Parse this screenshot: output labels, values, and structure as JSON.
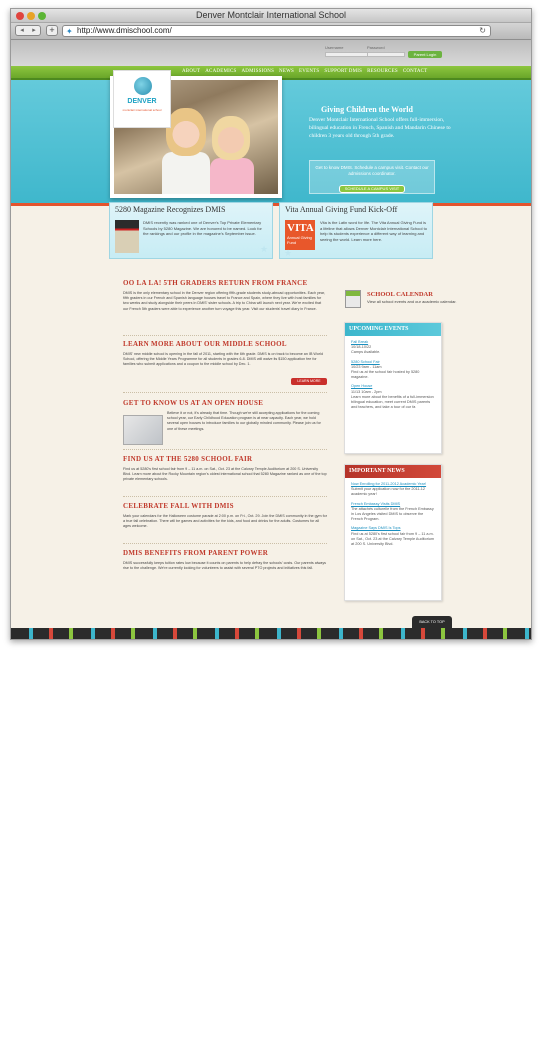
{
  "browser": {
    "title": "Denver Montclair International School",
    "url": "http://www.dmischool.com/",
    "back_glyph": "◂",
    "forward_glyph": "▸",
    "add_glyph": "+",
    "reload_glyph": "↻"
  },
  "site": {
    "login": {
      "username_label": "Username",
      "password_label": "Password",
      "button": "Parent Login"
    },
    "nav": [
      "ABOUT",
      "ACADEMICS",
      "ADMISSIONS",
      "NEWS",
      "EVENTS",
      "SUPPORT DMIS",
      "RESOURCES",
      "CONTACT"
    ],
    "logo": {
      "name": "DENVER",
      "sub": "montclair international school"
    },
    "hero": {
      "title": "Giving Children the World",
      "text": "Denver Montclair International School offers full-immersion, bilingual education in French, Spanish and Mandarin Chinese to children 3 years old through 5th grade.",
      "cta_text": "Get to know DMIS. Schedule a campus visit. Contact our admissions coordinator.",
      "cta_button": "SCHEDULE A CAMPUS VISIT"
    },
    "features": [
      {
        "title": "5280 Magazine Recognizes DMIS",
        "text": "DMIS recently was ranked one of Denver's Top Private Elementary Schools by 5280 Magazine. We are honored to be named. Look for the rankings and our profile in the magazine's September issue."
      },
      {
        "title": "Vita Annual Giving Fund Kick-Off",
        "image_big": "VITA",
        "image_small": "Annual Giving Fund",
        "text": "Vita is the Latin word for life. The Vita Annual Giving Fund is a lifeline that allows Denver Montclair International School to help its students experience a different way of learning and seeing the world. Learn more here."
      }
    ],
    "articles": [
      {
        "title": "OO LA LA! 5TH GRADERS RETURN FROM FRANCE",
        "body": "DMIS is the only elementary school in the Denver region offering fifth-grade students study-abroad opportunities. Each year, fifth graders in our French and Spanish language houses travel to France and Spain, where they live with host families for two weeks and study alongside their peers in DMIS' sister schools. A trip to China will launch next year. We're excited that our French 5th graders were able to experience another turn voyage this year. Visit our students' travel diary in France."
      },
      {
        "title": "LEARN MORE ABOUT OUR MIDDLE SCHOOL",
        "body": "DMIS' new middle school is opening in the fall of 2011, starting with the 6th grade. DMIS is on track to become an IB World School, offering the Middle Years Programme for all students in grades 6-8. DMIS will waive its $150 application fee for families who submit applications and a coupon to the middle school by Dec. 1.",
        "button": "LEARN MORE"
      },
      {
        "title": "GET TO KNOW US AT AN OPEN HOUSE",
        "body": "Believe it or not, it's already that time. Though we're still accepting applications for the coming school year, our Early Childhood Education program is at near capacity. Each year, we hold several open houses to introduce families to our globally minded community. Please join us for one of these meetings."
      },
      {
        "title": "FIND US AT THE 5280 SCHOOL FAIR",
        "body": "Find us at 5280's first school fair from 9 – 11 a.m. on Sat., Oct. 23 at the Calvary Temple Auditorium at 200 S. University Blvd. Learn more about the Rocky Mountain region's oldest international school that 5280 Magazine ranked as one of the top private elementary schools."
      },
      {
        "title": "CELEBRATE FALL WITH DMIS",
        "body": "Mark your calendars for the Halloween costume parade at 2:00 p.m. on Fri., Oct. 29. Join the DMIS community in the gym for a true fall celebration. There will be games and activities for the kids, and food and drinks for the adults. Costumes for all ages welcome."
      },
      {
        "title": "DMIS BENEFITS FROM PARENT POWER",
        "body": "DMIS successfully keeps tuition rates low because it counts on parents to help defray the schools' costs. Our parents always rise to the challenge. We're currently looking for volunteers to assist with several PTO projects and initiatives this fall."
      }
    ],
    "calendar": {
      "title": "SCHOOL CALENDAR",
      "sub": "View all school events and our academic calendar."
    },
    "events": {
      "title": "UPCOMING EVENTS",
      "items": [
        {
          "link": "Fall Break",
          "line1": "10/18-10/22",
          "line2": "Camps Available."
        },
        {
          "link": "5280 School Fair",
          "line1": "10/23 9am - 11am",
          "line2": "Find us at the school fair hosted by 5280 magazine."
        },
        {
          "link": "Open House",
          "line1": "11/13 10am - 2pm",
          "line2": "Learn more about the benefits of a full-immersion bilingual education, meet current DMIS parents and teachers, and take a tour of our fa"
        }
      ]
    },
    "news": {
      "title": "IMPORTANT NEWS",
      "items": [
        {
          "link": "Now Enrolling for 2011-2012 Academic Year!",
          "text": "Submit your application now for the 2011-12 academic year!"
        },
        {
          "link": "French Embassy Visits DMIS",
          "text": "The attachés culturelle from the French Embassy in Los Angeles visited DMIS to observe the French Program."
        },
        {
          "link": "Magazine Says DMIS Is Tops",
          "text": "Find us at 5280's first school fair from 9 – 11 a.m. on Sat., Oct. 23 at the Calvary Temple Auditorium at 200 S. University Blvd."
        }
      ]
    },
    "back_to_top": "BACK TO TOP"
  },
  "colors": {
    "nav_green": "#8dc63f",
    "hero_teal": "#3fb7cc",
    "accent_red": "#c0392b",
    "link_blue": "#1a8fbf"
  },
  "icons": [
    "reload-icon",
    "site-favicon",
    "calendar-icon",
    "star-icon"
  ]
}
